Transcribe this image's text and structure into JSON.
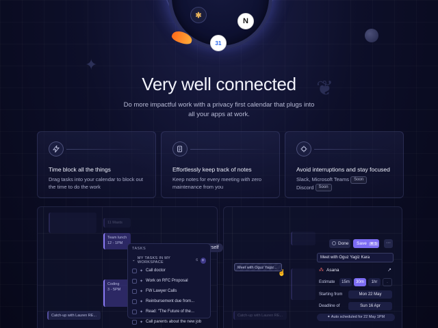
{
  "hero": {
    "title": "Very well connected",
    "subtitle": "Do more impactful work with a privacy first calendar that plugs into all your apps at work."
  },
  "orbit_apps": [
    {
      "icon": "slack-icon",
      "glyph": "✱"
    },
    {
      "icon": "notion-icon",
      "glyph": "N"
    },
    {
      "icon": "google-calendar-icon",
      "glyph": "31"
    }
  ],
  "features": [
    {
      "icon": "lightning-icon",
      "title": "Time block all the things",
      "text": "Drag tasks into your calendar to block out the time to do the work"
    },
    {
      "icon": "notes-icon",
      "title": "Effortlessly keep track of notes",
      "text": "Keep notes for every meeting with zero maintenance from you"
    },
    {
      "icon": "focus-icon",
      "title": "Avoid interruptions and stay focused",
      "text_1": "Slack, Microsoft Teams",
      "badge_1": "Soon",
      "text_2": "Discord",
      "badge_2": "Soon"
    }
  ],
  "calendar_left": {
    "events": [
      {
        "label": "11 Masts"
      },
      {
        "label": "Team lunch",
        "sub": "12 - 1PM"
      },
      {
        "label": "Coding",
        "sub": "3 - 5PM"
      },
      {
        "label": "Catch-up with Lauren RE..."
      }
    ]
  },
  "tasks": {
    "try_label": "Try it yourself",
    "header": "TASKS",
    "workspace_label": "MY TASKS IN MY WORKSPACE",
    "workspace_count": "6",
    "add_glyph": "+",
    "items": [
      "Call doctor",
      "Work on RFC Proposal",
      "FW Lawyer Calls",
      "Reinbursement due from...",
      "Read: \"The Future of the...",
      "Call parents about the new job"
    ]
  },
  "calendar_right": {
    "drag_chip": "Meet with Oguz Yagiz...",
    "events": [
      {
        "label": "Catch-up with Lauren RE..."
      }
    ]
  },
  "detail": {
    "done_label": "Done",
    "save_label": "Save",
    "save_shortcut": "⌘ S",
    "more_glyph": "···",
    "title_value": "Meet with Oguz Yagiz Kara",
    "integration": "Asana",
    "estimate_label": "Estimate",
    "estimate_options": [
      "15m",
      "30m",
      "1hr",
      "·"
    ],
    "estimate_selected": "30m",
    "starting_label": "Starting from",
    "starting_value": "Mon 22 May",
    "deadline_label": "Deadline of",
    "deadline_value": "Sun 16 Apr",
    "auto_scheduled": "Auto scheduled for 22 May 1PM"
  },
  "colors": {
    "accent": "#7c6cf2",
    "background": "#0d0f29",
    "asana": "#f06a6a"
  }
}
